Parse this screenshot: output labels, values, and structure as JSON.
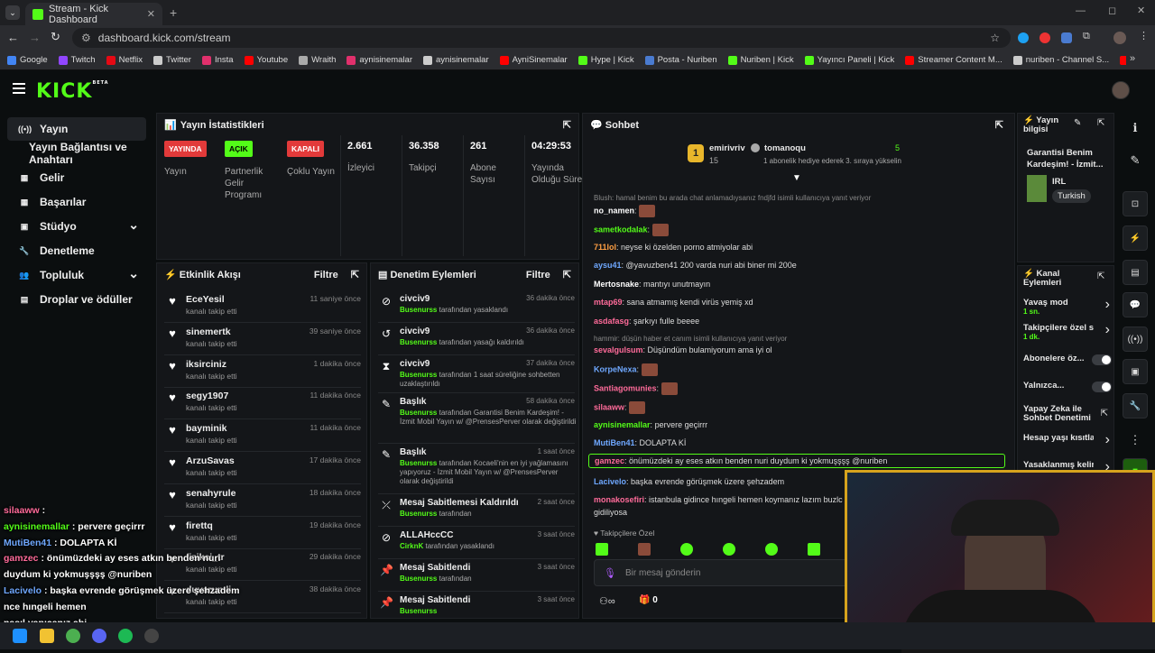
{
  "browser": {
    "tab_title": "Stream - Kick Dashboard",
    "url": "dashboard.kick.com/stream",
    "bookmarks": [
      "Google",
      "Twitch",
      "Netflix",
      "Twitter",
      "Insta",
      "Youtube",
      "Wraith",
      "aynisinemalar",
      "aynisinemalar",
      "AyniSinemalar",
      "Hype | Kick",
      "Posta - Nuriben",
      "Nuriben | Kick",
      "Yayıncı Paneli | Kick",
      "Streamer Content M...",
      "nuriben - Channel S...",
      "Aynı Sinemalar - Ça..."
    ]
  },
  "header": {
    "logo": "KICK",
    "beta": "BETA"
  },
  "sidebar": {
    "items": [
      {
        "label": "Yayın",
        "icon": "broadcast-icon"
      },
      {
        "label": "Yayın Bağlantısı ve Anahtarı",
        "icon": ""
      },
      {
        "label": "Gelir",
        "icon": "revenue-icon"
      },
      {
        "label": "Başarılar",
        "icon": "achievements-icon"
      },
      {
        "label": "Stüdyo",
        "icon": "studio-icon"
      },
      {
        "label": "Denetleme",
        "icon": "moderation-icon"
      },
      {
        "label": "Topluluk",
        "icon": "community-icon"
      },
      {
        "label": "Droplar ve ödüller",
        "icon": "drops-icon"
      }
    ]
  },
  "stats": {
    "title": "Yayın İstatistikleri",
    "cols": [
      {
        "tag": "YAYINDA",
        "label": "Yayın",
        "color": "#e23a3a"
      },
      {
        "tag": "AÇIK",
        "label": "Partnerlik Gelir Programı",
        "color": "#53fc18"
      },
      {
        "tag": "KAPALI",
        "label": "Çoklu Yayın",
        "color": "#e23a3a"
      },
      {
        "value": "2.661",
        "label": "İzleyici"
      },
      {
        "value": "36.358",
        "label": "Takipçi"
      },
      {
        "value": "261",
        "label": "Abone Sayısı"
      },
      {
        "value": "04:29:53",
        "label": "Yayında Olduğu Süre"
      }
    ]
  },
  "activity": {
    "title": "Etkinlik Akışı",
    "filter": "Filtre",
    "items": [
      {
        "name": "EceYesil",
        "sub": "kanalı takip etti",
        "time": "11 saniye önce"
      },
      {
        "name": "sinemertk",
        "sub": "kanalı takip etti",
        "time": "39 saniye önce"
      },
      {
        "name": "iksirciniz",
        "sub": "kanalı takip etti",
        "time": "1 dakika önce"
      },
      {
        "name": "segy1907",
        "sub": "kanalı takip etti",
        "time": "11 dakika önce"
      },
      {
        "name": "bayminik",
        "sub": "kanalı takip etti",
        "time": "11 dakika önce"
      },
      {
        "name": "ArzuSavas",
        "sub": "kanalı takip etti",
        "time": "17 dakika önce"
      },
      {
        "name": "senahyrule",
        "sub": "kanalı takip etti",
        "time": "18 dakika önce"
      },
      {
        "name": "firettq",
        "sub": "kanalı takip etti",
        "time": "19 dakika önce"
      },
      {
        "name": "fizikci_tr",
        "sub": "kanalı takip etti",
        "time": "29 dakika önce"
      },
      {
        "name": "duvarumli",
        "sub": "kanalı takip etti",
        "time": "38 dakika önce"
      }
    ]
  },
  "moderation": {
    "title": "Denetim Eylemleri",
    "filter": "Filtre",
    "items": [
      {
        "name": "civciv9",
        "mod": "Busenurss",
        "sub": "tarafından yasaklandı",
        "time": "36 dakika önce",
        "icon": "ban-icon"
      },
      {
        "name": "civciv9",
        "mod": "Busenurss",
        "sub": "tarafından yasağı kaldırıldı",
        "time": "36 dakika önce",
        "icon": "unban-icon"
      },
      {
        "name": "civciv9",
        "mod": "Busenurss",
        "sub": "tarafından 1 saat süreliğine sohbetten uzaklaştırıldı",
        "time": "37 dakika önce",
        "icon": "timeout-icon"
      },
      {
        "name": "Başlık",
        "mod": "Busenurss",
        "sub": "tarafından Garantisi Benim Kardeşim! - İzmit Mobil Yayın w/ @PrensesPerver olarak değiştirildi",
        "time": "58 dakika önce",
        "icon": "title-edit-icon"
      },
      {
        "name": "Başlık",
        "mod": "Busenurss",
        "sub": "tarafından Kocaeli'nin en iyi yağlamasını yapıyoruz - İzmit Mobil Yayın w/ @PrensesPerver olarak değiştirildi",
        "time": "1 saat önce",
        "icon": "title-edit-icon"
      },
      {
        "name": "Mesaj Sabitlemesi Kaldırıldı",
        "mod": "Busenurss",
        "sub": "tarafından",
        "time": "2 saat önce",
        "icon": "unpin-icon"
      },
      {
        "name": "ALLAHccCC",
        "mod": "CirknK",
        "sub": "tarafından yasaklandı",
        "time": "3 saat önce",
        "icon": "ban-icon"
      },
      {
        "name": "Mesaj Sabitlendi",
        "mod": "Busenurss",
        "sub": "tarafından",
        "time": "3 saat önce",
        "icon": "pin-icon"
      },
      {
        "name": "Mesaj Sabitlendi",
        "mod": "Busenurss",
        "sub": "",
        "time": "3 saat önce",
        "icon": "pin-icon"
      }
    ]
  },
  "chat": {
    "title": "Sohbet",
    "pinned": {
      "gifter": "emirivriv",
      "gifter_count": "15",
      "recipient": "tomanoqu",
      "recipient_count": "5",
      "text": "1 abonelik hediye ederek 3. sıraya yükselin"
    },
    "lines": [
      {
        "reply": "Blush: hamal benim bu arada chat anlamadıysanız fndjfd isimli kullanıcıya yanıt veriyor"
      },
      {
        "user": "no_namen",
        "color": "#ffffff",
        "text": "",
        "emote": true
      },
      {
        "user": "sametkodalak",
        "color": "#53fc18",
        "text": "",
        "emote": true
      },
      {
        "user": "711lol",
        "color": "#ff9f43",
        "text": "neyse ki özelden porno atmiyolar abi"
      },
      {
        "user": "aysu41",
        "color": "#6fa8ff",
        "text": "@yavuzben41 200 varda nuri abi biner mi 200e"
      },
      {
        "user": "Mertosnake",
        "color": "#ffffff",
        "text": "mantıyı unutmayın"
      },
      {
        "user": "mtap69",
        "color": "#ff6b9a",
        "text": "sana atmamış kendi virüs yemiş xd"
      },
      {
        "user": "asdafasg",
        "color": "#ff6b9a",
        "text": "şarkıyı fulle beeee"
      },
      {
        "reply": "hammir: düşün haber et canım isimli kullanıcıya yanıt veriyor"
      },
      {
        "user": "sevalgulsum",
        "color": "#ff6b9a",
        "text": "Düşündüm bulamiyorum ama iyi ol"
      },
      {
        "user": "KorpeNexa",
        "color": "#6fa8ff",
        "text": "",
        "emote": true
      },
      {
        "user": "Santiagomunies",
        "color": "#ff6b9a",
        "text": "",
        "emote": true
      },
      {
        "user": "silaaww",
        "color": "#ff6b9a",
        "text": "",
        "emote": true
      },
      {
        "user": "aynisinemallar",
        "color": "#53fc18",
        "text": "pervere geçirrr"
      },
      {
        "user": "MutiBen41",
        "color": "#6fa8ff",
        "text": "DOLAPTA Kİ"
      },
      {
        "user": "gamzec",
        "color": "#ff6b9a",
        "text": "önümüzdeki ay eses atkın benden nuri duydum ki yokmuşşşş @nuriben",
        "highlight": true
      },
      {
        "user": "Lacivelo",
        "color": "#6fa8ff",
        "text": "başka evrende görüşmek üzere şehzadem"
      },
      {
        "user": "monakosefiri",
        "color": "#ff6b9a",
        "text": "istanbula gidince hıngeli hemen koymanız lazım buzlc"
      },
      {
        "text": "gidiliyosa",
        "user": "",
        "color": "#ffffff"
      }
    ],
    "followers_only": "Takipçilere Özel",
    "input_placeholder": "Bir mesaj gönderin",
    "points": "0"
  },
  "stream_info": {
    "title": "Yayın bilgisi",
    "stream_title": "Garantisi Benim Kardeşim! - İzmit...",
    "category": "IRL",
    "language": "Turkish"
  },
  "channel_actions": {
    "title": "Kanal Eylemleri",
    "items": [
      {
        "label": "Yavaş mod",
        "sub": "1 sn.",
        "kind": "chevron"
      },
      {
        "label": "Takipçilere özel s...",
        "sub": "1 dk.",
        "kind": "chevron"
      },
      {
        "label": "Abonelere öz...",
        "sub": "",
        "kind": "toggle"
      },
      {
        "label": "Yalnızca...",
        "sub": "",
        "kind": "toggle"
      },
      {
        "label": "Yapay Zeka ile Sohbet Denetimi",
        "sub": "",
        "kind": "link"
      },
      {
        "label": "Hesap yaşı kısıtla",
        "sub": "",
        "kind": "chevron"
      },
      {
        "label": "Yasaklanmış kelin",
        "sub": "",
        "kind": "chevron"
      }
    ]
  },
  "overlay_chat": [
    {
      "user": "silaaww",
      "color": "#ff6b9a",
      "text": ":"
    },
    {
      "user": "aynisinemallar",
      "color": "#53fc18",
      "text": ": pervere geçirrr"
    },
    {
      "user": "MutiBen41",
      "color": "#6fa8ff",
      "text": ": DOLAPTA Kİ"
    },
    {
      "user": "gamzec",
      "color": "#ff6b9a",
      "text": ": önümüzdeki ay eses atkın benden nuri"
    },
    {
      "user": "",
      "color": "#fff",
      "text": "duydum ki yokmuşşşş @nuriben"
    },
    {
      "user": "Lacivelo",
      "color": "#6fa8ff",
      "text": ": başka evrende görüşmek üzere şehzadem"
    },
    {
      "user": "",
      "color": "#fff",
      "text": "nce hıngeli hemen"
    },
    {
      "user": "",
      "color": "#fff",
      "text": "nasıl yapıcanız abi"
    }
  ],
  "colors": {
    "accent": "#53fc18",
    "panel": "#141619",
    "bg": "#0b0e0f"
  }
}
